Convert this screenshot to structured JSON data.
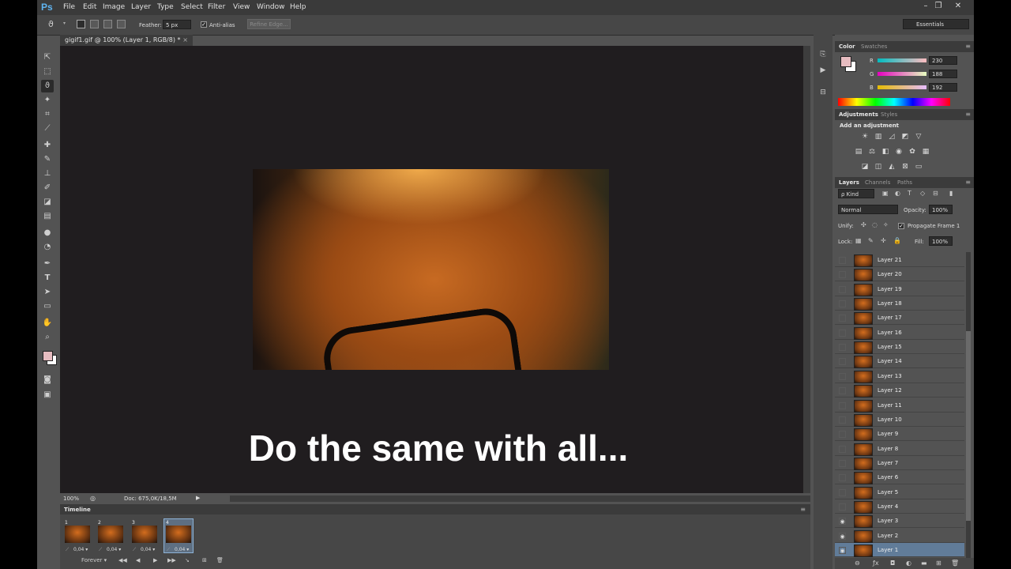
{
  "menu": {
    "logo": "Ps",
    "items": [
      "File",
      "Edit",
      "Image",
      "Layer",
      "Type",
      "Select",
      "Filter",
      "View",
      "Window",
      "Help"
    ]
  },
  "window_controls": {
    "minimize": "–",
    "restore": "❐",
    "close": "✕"
  },
  "options": {
    "feather_label": "Feather:",
    "feather_value": "5 px",
    "antialias_label": "Anti-alias",
    "refine_label": "Refine Edge...",
    "workspace": "Essentials"
  },
  "document": {
    "tab_title": "gigif1.gif @ 100% (Layer 1, RGB/8) *",
    "close": "×",
    "zoom": "100%",
    "doc_info": "Doc: 675,0K/18,5M",
    "caption": "Do the same with all..."
  },
  "timeline": {
    "title": "Timeline",
    "frames": [
      {
        "num": "1",
        "delay": "0,04 ▾"
      },
      {
        "num": "2",
        "delay": "0,04 ▾"
      },
      {
        "num": "3",
        "delay": "0,04 ▾"
      },
      {
        "num": "4",
        "delay": "0,04 ▾"
      }
    ],
    "loop": "Forever ▾"
  },
  "color_panel": {
    "tabs": [
      "Color",
      "Swatches"
    ],
    "r_label": "R",
    "g_label": "G",
    "b_label": "B",
    "r": "230",
    "g": "188",
    "b": "192",
    "foreground": "#e6bcc0",
    "background": "#ffffff"
  },
  "adjustments_panel": {
    "tabs": [
      "Adjustments",
      "Styles"
    ],
    "subtitle": "Add an adjustment"
  },
  "layers_panel": {
    "tabs": [
      "Layers",
      "Channels",
      "Paths"
    ],
    "kind": "ρ Kind",
    "blend_mode": "Normal",
    "opacity_label": "Opacity:",
    "opacity": "100%",
    "unify_label": "Unify:",
    "propagate_label": "Propagate Frame 1",
    "lock_label": "Lock:",
    "fill_label": "Fill:",
    "fill": "100%",
    "layers": [
      "Layer 21",
      "Layer 20",
      "Layer 19",
      "Layer 18",
      "Layer 17",
      "Layer 16",
      "Layer 15",
      "Layer 14",
      "Layer 13",
      "Layer 12",
      "Layer 11",
      "Layer 10",
      "Layer 9",
      "Layer 8",
      "Layer 7",
      "Layer 6",
      "Layer 5",
      "Layer 4",
      "Layer 3",
      "Layer 2",
      "Layer 1"
    ],
    "visible_layers": [
      "Layer 3",
      "Layer 2",
      "Layer 1"
    ],
    "selected_layer": "Layer 1"
  }
}
